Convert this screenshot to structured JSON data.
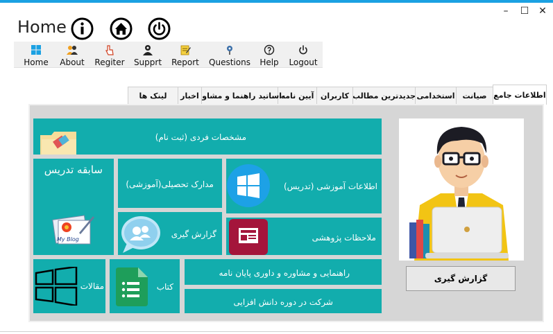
{
  "window": {
    "minimize_glyph": "–",
    "maximize_glyph": "☐",
    "close_glyph": "✕"
  },
  "header": {
    "title": "Home",
    "icons": [
      "info-icon",
      "home-icon",
      "power-icon"
    ]
  },
  "menu": {
    "items": [
      {
        "label": "Home",
        "icon": "windows-icon"
      },
      {
        "label": "About",
        "icon": "people-icon"
      },
      {
        "label": "Regiter",
        "icon": "pointer-icon"
      },
      {
        "label": "Supprt",
        "icon": "user-icon"
      },
      {
        "label": "Report",
        "icon": "report-icon"
      },
      {
        "label": "Questions",
        "icon": "question-icon"
      },
      {
        "label": "Help",
        "icon": "help-icon"
      },
      {
        "label": "Logout",
        "icon": "power-icon"
      }
    ]
  },
  "tabs": [
    {
      "label": "اطلاعات جامع",
      "active": true
    },
    {
      "label": "صیانت",
      "active": false
    },
    {
      "label": "استخدامی",
      "active": false
    },
    {
      "label": "جدیدترین مطالب",
      "active": false
    },
    {
      "label": "کاربران",
      "active": false
    },
    {
      "label": "آیین نامه",
      "active": false
    },
    {
      "label": "اساتید راهنما و مشاور",
      "active": false
    },
    {
      "label": "اخبار",
      "active": false
    },
    {
      "label": "لینک ها",
      "active": false
    }
  ],
  "tiles": {
    "personal": "مشخصات فردی (ثبت نام)",
    "teaching_history": "سابقه تدریس",
    "documents": "مدارک تحصیلی(آموزشی)",
    "education_info": "اطلاعات آموزشی (تدریس)",
    "report": "گزارش گیری",
    "research": "ملاحظات پژوهشی",
    "articles": "مقالات",
    "book": "کتاب",
    "guidance": "راهنمایی و مشاوره و داوری پایان نامه",
    "training": "شرکت در دوره دانش افزایی",
    "blog_caption": "My Blog"
  },
  "right": {
    "report_button": "گزارش گیری"
  },
  "colors": {
    "tile": "#12adad",
    "accent": "#1ba1e2",
    "panel": "#d6d6d6"
  }
}
